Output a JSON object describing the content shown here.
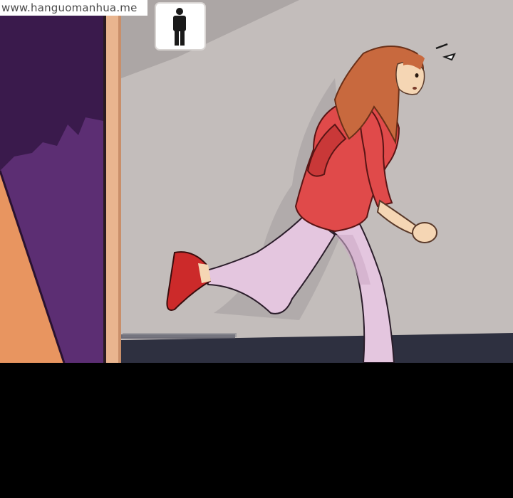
{
  "watermark": {
    "text": "www.hanguomanhua.me"
  },
  "scene": {
    "subject": "running-woman-figure",
    "wall_sign": "person-silhouette-sign-icon",
    "colors": {
      "wall": "#c3bdbb",
      "floor": "#2e3040",
      "door_purple": "#5c2e73",
      "door_frame": "#e9b58f",
      "orange_wall": "#d9844a",
      "shirt": "#e04a4a",
      "pants": "#e4c6df",
      "shoes": "#cc2a2a",
      "hair": "#c8693e",
      "skin": "#f5d6b4",
      "background": "#000000"
    }
  }
}
